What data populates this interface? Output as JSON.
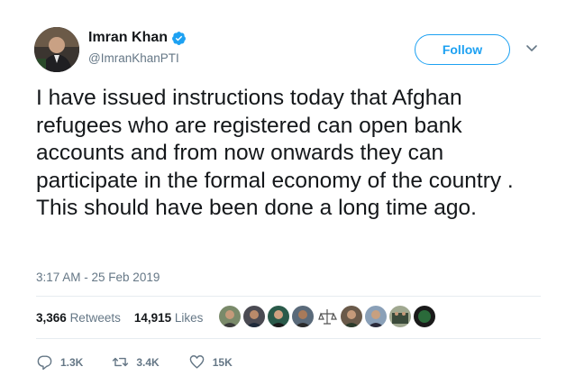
{
  "author": {
    "name": "Imran Khan",
    "handle": "@ImranKhanPTI",
    "verified": true
  },
  "follow_label": "Follow",
  "tweet": {
    "text": "I have issued instructions today that Afghan refugees who are registered can open bank accounts and from now onwards they can participate in the formal economy of the country . This should have been done a long time ago.",
    "timestamp": "3:17 AM - 25 Feb 2019"
  },
  "stats": {
    "retweets_count": "3,366",
    "retweets_label": "Retweets",
    "likes_count": "14,915",
    "likes_label": "Likes"
  },
  "actions": {
    "replies": "1.3K",
    "retweets": "3.4K",
    "likes": "15K"
  },
  "colors": {
    "accent": "#1da1f2",
    "secondary_text": "#657786",
    "divider": "#e6ecf0"
  }
}
